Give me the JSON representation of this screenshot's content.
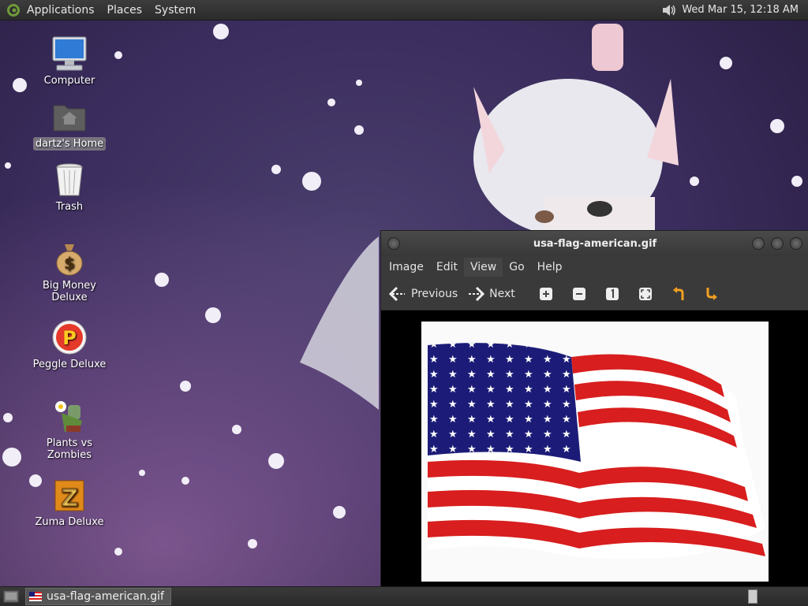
{
  "top_panel": {
    "menus": [
      "Applications",
      "Places",
      "System"
    ],
    "clock": "Wed Mar 15, 12:18 AM",
    "volume_icon": "volume-icon"
  },
  "desktop_icons": [
    {
      "label": "Computer",
      "icon": "computer-icon"
    },
    {
      "label": "dartz's Home",
      "icon": "home-folder-icon",
      "selected": true
    },
    {
      "label": "Trash",
      "icon": "trash-icon"
    },
    {
      "label": "Big Money Deluxe",
      "icon": "money-bag-icon"
    },
    {
      "label": "Peggle Deluxe",
      "icon": "peggle-icon"
    },
    {
      "label": "Plants vs Zombies",
      "icon": "plants-icon"
    },
    {
      "label": "Zuma Deluxe",
      "icon": "zuma-icon"
    }
  ],
  "viewer": {
    "title": "usa-flag-american.gif",
    "menus": [
      "Image",
      "Edit",
      "View",
      "Go",
      "Help"
    ],
    "active_menu": "View",
    "toolbar": {
      "previous_label": "Previous",
      "next_label": "Next",
      "icons": [
        "zoom-in-icon",
        "zoom-out-icon",
        "normal-size-icon",
        "best-fit-icon",
        "rotate-left-icon",
        "rotate-right-icon"
      ]
    }
  },
  "bottom_panel": {
    "task_label": "usa-flag-american.gif"
  },
  "colors": {
    "flag_red": "#d81e1e",
    "flag_blue": "#1c1c78",
    "panel_bg": "#2e2e2e"
  }
}
